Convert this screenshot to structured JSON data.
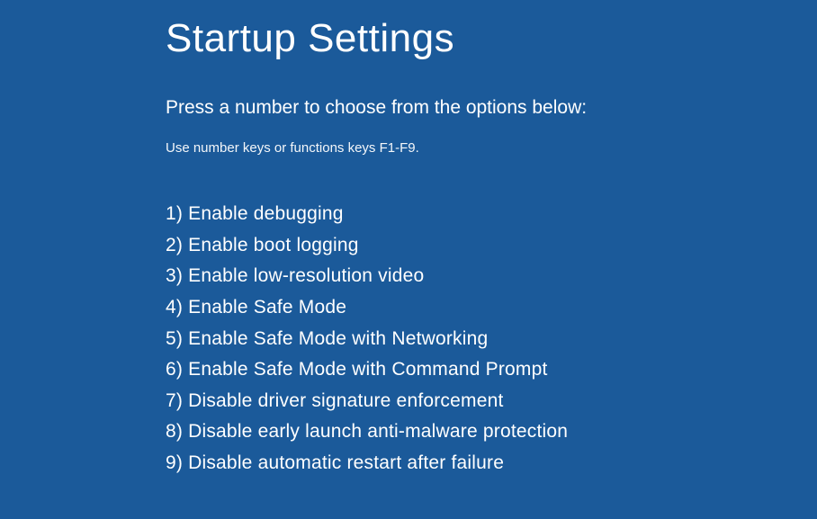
{
  "title": "Startup Settings",
  "subtitle": "Press a number to choose from the options below:",
  "hint": "Use number keys or functions keys F1-F9.",
  "options": [
    {
      "num": "1",
      "label": "Enable debugging"
    },
    {
      "num": "2",
      "label": "Enable boot logging"
    },
    {
      "num": "3",
      "label": "Enable low-resolution video"
    },
    {
      "num": "4",
      "label": "Enable Safe Mode"
    },
    {
      "num": "5",
      "label": "Enable Safe Mode with Networking"
    },
    {
      "num": "6",
      "label": "Enable Safe Mode with Command Prompt"
    },
    {
      "num": "7",
      "label": "Disable driver signature enforcement"
    },
    {
      "num": "8",
      "label": "Disable early launch anti-malware protection"
    },
    {
      "num": "9",
      "label": "Disable automatic restart after failure"
    }
  ]
}
